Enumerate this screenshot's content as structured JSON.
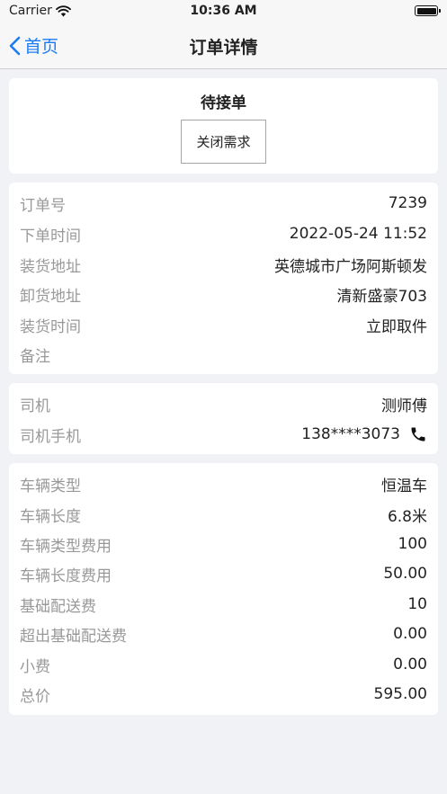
{
  "status_bar": {
    "carrier": "Carrier",
    "time": "10:36 AM"
  },
  "nav": {
    "back_label": "首页",
    "title": "订单详情"
  },
  "status_card": {
    "status": "待接单",
    "close_label": "关闭需求"
  },
  "order_info": [
    {
      "label": "订单号",
      "value": "7239"
    },
    {
      "label": "下单时间",
      "value": "2022-05-24 11:52"
    },
    {
      "label": "装货地址",
      "value": "英德城市广场阿斯顿发"
    },
    {
      "label": "卸货地址",
      "value": "清新盛豪703"
    },
    {
      "label": "装货时间",
      "value": "立即取件"
    },
    {
      "label": "备注",
      "value": ""
    }
  ],
  "driver_info": [
    {
      "label": "司机",
      "value": "测师傅"
    },
    {
      "label": "司机手机",
      "value": "138****3073"
    }
  ],
  "fee_info": [
    {
      "label": "车辆类型",
      "value": "恒温车"
    },
    {
      "label": "车辆长度",
      "value": "6.8米"
    },
    {
      "label": "车辆类型费用",
      "value": "100"
    },
    {
      "label": "车辆长度费用",
      "value": "50.00"
    },
    {
      "label": "基础配送费",
      "value": "10"
    },
    {
      "label": "超出基础配送费",
      "value": "0.00"
    },
    {
      "label": "小费",
      "value": "0.00"
    },
    {
      "label": "总价",
      "value": "595.00"
    }
  ],
  "icons": {
    "wifi": "wifi-icon",
    "battery": "battery-icon",
    "back": "chevron-left-icon",
    "phone": "phone-icon"
  },
  "colors": {
    "accent": "#1a7cf5",
    "label": "#999999",
    "background": "#f1f2f6"
  }
}
